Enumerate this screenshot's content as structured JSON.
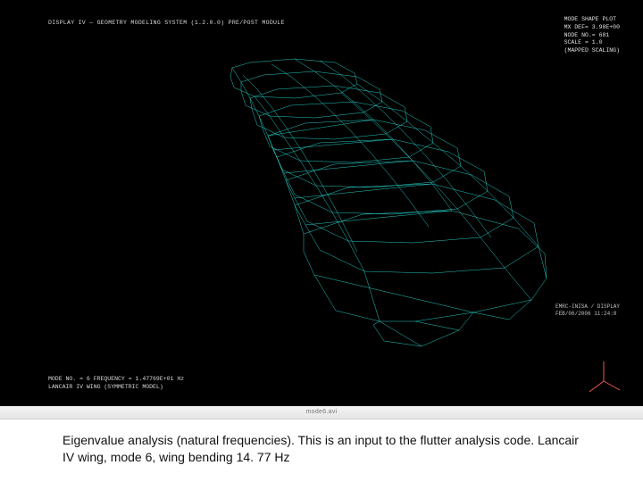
{
  "viewer": {
    "header_bar": "DISPLAY IV — GEOMETRY MODELING SYSTEM (1.2.0.0)  PRE/POST MODULE",
    "info_block": {
      "line1": "MODE SHAPE PLOT",
      "line2": "MX DEF= 3.98E+00",
      "line3": "NODE NO.= 681",
      "line4": "SCALE = 1.0",
      "line5": "(MAPPED SCALING)"
    },
    "midright": {
      "line1": "EMRC-INISA / DISPLAY",
      "line2": "FEB/06/2006   11:24:8"
    },
    "footer_block": {
      "line1": "MODE NO. =  6   FREQUENCY = 1.47769E+01 Hz",
      "line2": "LANCAIR IV WING (SYMMETRIC MODEL)"
    },
    "filename": "mode6.avi",
    "mesh_color": "#28e0d6",
    "accent_axis_color": "#e85a4f"
  },
  "caption": "Eigenvalue analysis (natural frequencies). This is an input to the flutter analysis code. Lancair IV wing, mode 6, wing bending 14. 77 Hz"
}
